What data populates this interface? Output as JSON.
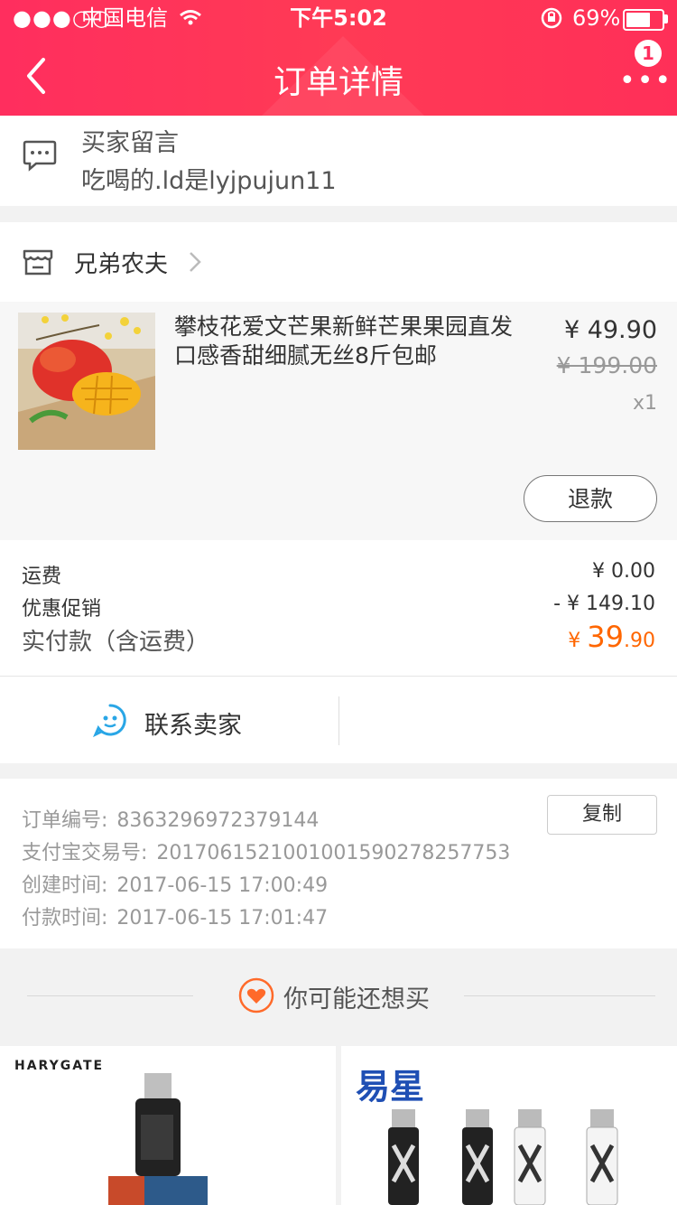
{
  "status_bar": {
    "signal": "●●●○○",
    "carrier": "中国电信",
    "time": "下午5:02",
    "battery": "69%"
  },
  "header": {
    "title": "订单详情",
    "badge_count": "1",
    "more": "•••"
  },
  "buyer_message": {
    "label": "买家留言",
    "text": "吃喝的.ld是lyjpujun11"
  },
  "store": {
    "name": "兄弟农夫"
  },
  "product": {
    "name": "攀枝花爱文芒果新鲜芒果果园直发口感香甜细腻无丝8斤包邮",
    "price": "¥ 49.90",
    "original_price": "¥ 199.00",
    "quantity": "x1",
    "refund_label": "退款"
  },
  "summary": {
    "shipping_label": "运费",
    "shipping_value": "¥ 0.00",
    "discount_label": "优惠促销",
    "discount_value": "- ¥ 149.10",
    "paid_label": "实付款（含运费）",
    "paid_symbol": "¥ ",
    "paid_int": "39",
    "paid_dec": ".90"
  },
  "contact": {
    "label": "联系卖家"
  },
  "order_info": {
    "order_no_label": "订单编号:",
    "order_no": "8363296972379144",
    "alipay_label": "支付宝交易号:",
    "alipay_no": "2017061521001001590278257753",
    "created_label": "创建时间:",
    "created": "2017-06-15 17:00:49",
    "paid_time_label": "付款时间:",
    "paid_time": "2017-06-15 17:01:47",
    "copy_label": "复制"
  },
  "recommend": {
    "title": "你可能还想买",
    "brand1": "HARYGATE",
    "brand2": "易星"
  },
  "colors": {
    "header": "#ff2e5e",
    "accent": "#ff6600",
    "contact_icon": "#29a6e6"
  }
}
